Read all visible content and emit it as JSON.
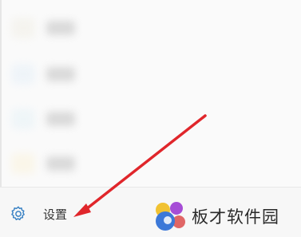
{
  "menu": {
    "items": [
      {
        "icon": "app-icon",
        "tint": "#f1efe6",
        "label_blur": "#cfcfcf"
      },
      {
        "icon": "app-icon",
        "tint": "#e6f0f8",
        "label_blur": "#cfcfcf"
      },
      {
        "icon": "app-icon",
        "tint": "#e6f2f7",
        "label_blur": "#cfcfcf"
      },
      {
        "icon": "app-icon",
        "tint": "#faf3dc",
        "label_blur": "#cfcfcf"
      }
    ]
  },
  "footer": {
    "settings_label": "设置",
    "settings_icon": "gear-icon",
    "accent": "#3a82c4"
  },
  "watermark": {
    "text": "板才软件园",
    "colors": [
      "#f1c232",
      "#3c78d8",
      "#a64dd6",
      "#e06666"
    ]
  },
  "annotation": {
    "arrow_color": "#e0262b"
  }
}
